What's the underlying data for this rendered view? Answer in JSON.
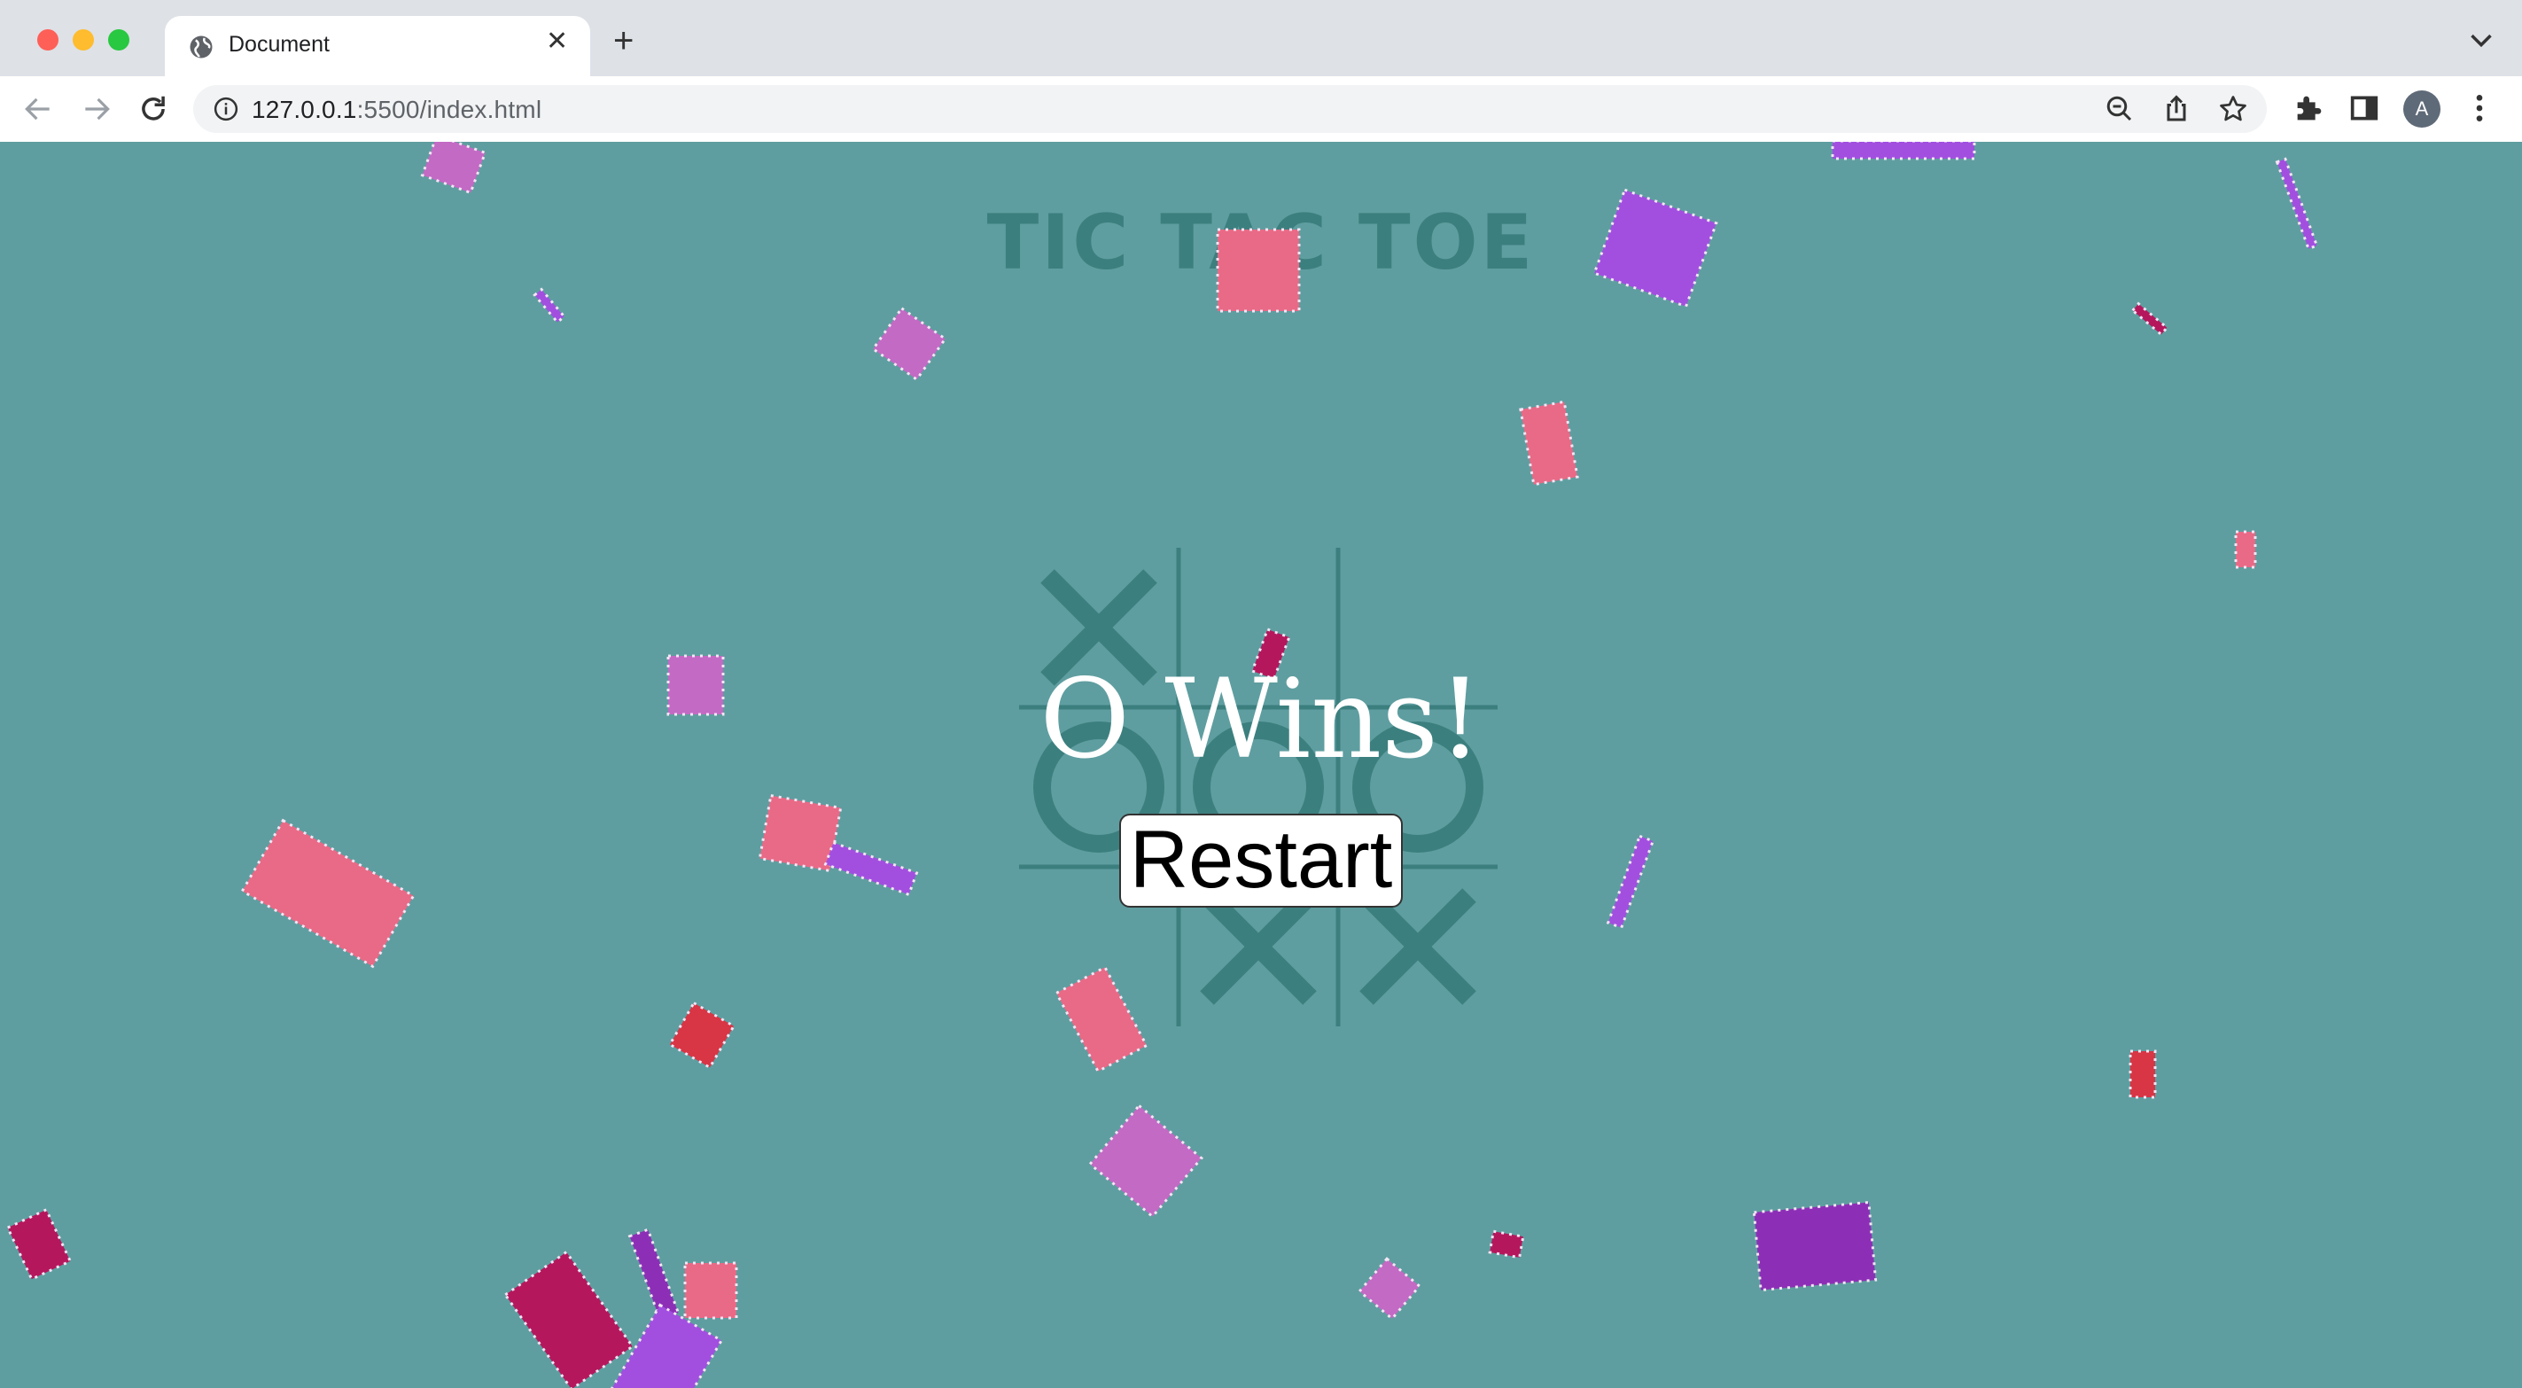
{
  "browser": {
    "tab_title": "Document",
    "url_host": "127.0.0.1",
    "url_rest": ":5500/index.html",
    "avatar_initial": "A"
  },
  "game": {
    "title": "TIC TAC TOE",
    "board": [
      "X",
      "",
      "",
      "O",
      "O",
      "O",
      "",
      "X",
      "X"
    ],
    "winner_text": "O Wins!",
    "restart_label": "Restart"
  },
  "colors": {
    "page_background": "#5f9ea0",
    "board_marks": "#3c7f7f",
    "confetti": [
      "#c36ac4",
      "#a24fe0",
      "#e86a86",
      "#b5175d",
      "#d83545",
      "#8d2fb6"
    ]
  }
}
